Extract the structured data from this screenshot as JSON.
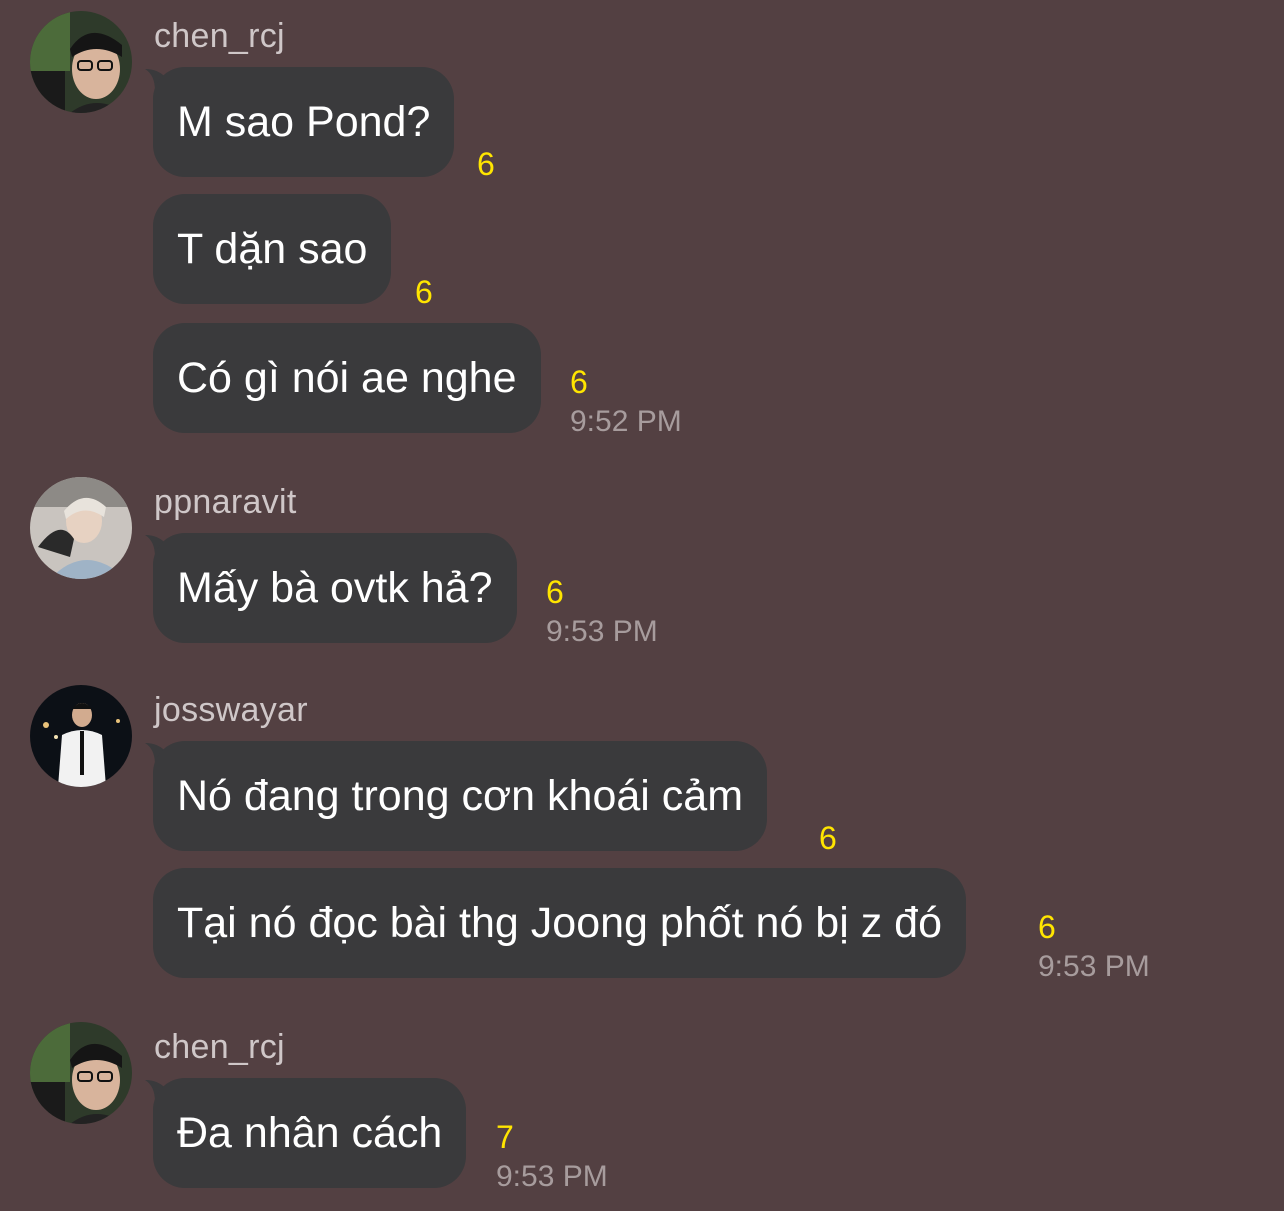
{
  "colors": {
    "background": "#534042",
    "bubble": "#3a3a3c",
    "bubble_text": "#ffffff",
    "sender": "#cfc7c8",
    "reaction_count": "#ffe500",
    "timestamp": "#a79c9d"
  },
  "groups": [
    {
      "sender": "chen_rcj",
      "avatar_icon": "avatar-photo",
      "messages": [
        {
          "text": "M sao Pond?",
          "count": "6",
          "time": ""
        },
        {
          "text": "T dặn sao",
          "count": "6",
          "time": ""
        },
        {
          "text": "Có gì nói ae nghe",
          "count": "6",
          "time": "9:52 PM"
        }
      ]
    },
    {
      "sender": "ppnaravit",
      "avatar_icon": "avatar-photo",
      "messages": [
        {
          "text": "Mấy bà ovtk hả?",
          "count": "6",
          "time": "9:53 PM"
        }
      ]
    },
    {
      "sender": "josswayar",
      "avatar_icon": "avatar-photo",
      "messages": [
        {
          "text": "Nó đang trong cơn khoái cảm",
          "count": "6",
          "time": ""
        },
        {
          "text": "Tại nó đọc bài thg Joong phốt nó bị z đó",
          "count": "6",
          "time": "9:53 PM"
        }
      ]
    },
    {
      "sender": "chen_rcj",
      "avatar_icon": "avatar-photo",
      "messages": [
        {
          "text": "Đa nhân cách",
          "count": "7",
          "time": "9:53 PM"
        }
      ]
    }
  ]
}
